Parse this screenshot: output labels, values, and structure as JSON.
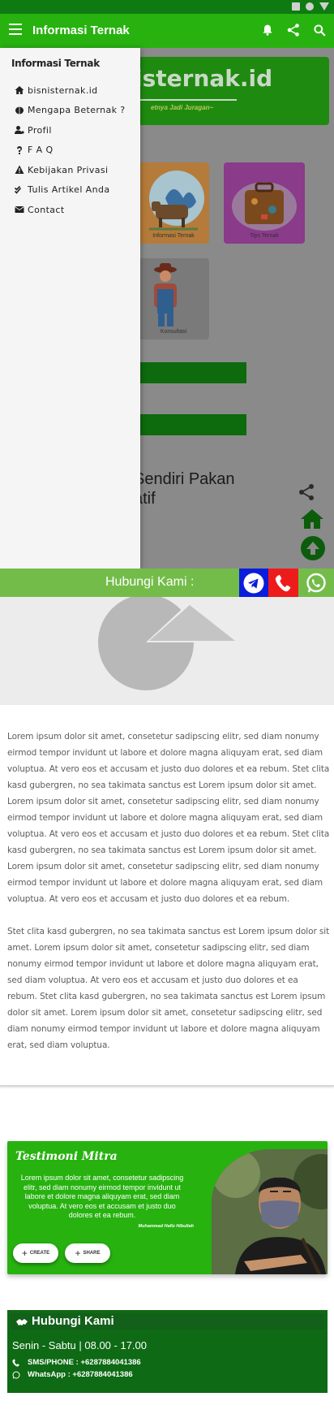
{
  "app_bar": {
    "title": "Informasi Ternak",
    "icons": [
      "menu-icon",
      "bell-icon",
      "share-icon",
      "search-icon"
    ],
    "color": "#27b210"
  },
  "background_page": {
    "hero_title": "isternak.id",
    "hero_subtitle": "etnya Jadi Juragan~",
    "tiles": [
      {
        "label": "Informasi Ternak"
      },
      {
        "label": "Tips Ternak"
      },
      {
        "label": "Konsultasi"
      }
    ],
    "article_title_line1": "Sendiri Pakan",
    "article_title_line2": "atif"
  },
  "drawer": {
    "title": "Informasi Ternak",
    "items": [
      {
        "label": "bisnisternak.id",
        "icon": "home-icon"
      },
      {
        "label": "Mengapa Beternak ?",
        "icon": "brain-icon"
      },
      {
        "label": "Profil",
        "icon": "user-gear-icon"
      },
      {
        "label": "F A Q",
        "icon": "question-icon"
      },
      {
        "label": "Kebijakan Privasi",
        "icon": "warning-icon"
      },
      {
        "label": "Tulis Artikel Anda",
        "icon": "check-double-icon"
      },
      {
        "label": "Contact",
        "icon": "envelope-icon"
      }
    ]
  },
  "contact_bar": {
    "label": "Hubungi Kami :",
    "buttons": [
      "telegram-icon",
      "phone-icon",
      "whatsapp-icon"
    ]
  },
  "article": {
    "paragraph1": "Lorem ipsum dolor sit amet, consetetur sadipscing elitr, sed diam nonumy eirmod tempor invidunt ut labore et dolore magna aliquyam erat, sed diam voluptua. At vero eos et accusam et justo duo dolores et ea rebum. Stet clita kasd gubergren, no sea takimata sanctus est Lorem ipsum dolor sit amet. Lorem ipsum dolor sit amet, consetetur sadipscing elitr, sed diam nonumy eirmod tempor invidunt ut labore et dolore magna aliquyam erat, sed diam voluptua. At vero eos et accusam et justo duo dolores et ea rebum. Stet clita kasd gubergren, no sea takimata sanctus est Lorem ipsum dolor sit amet. Lorem ipsum dolor sit amet, consetetur sadipscing elitr, sed diam nonumy eirmod tempor invidunt ut labore et dolore magna aliquyam erat, sed diam voluptua. At vero eos et accusam et justo duo dolores et ea rebum.",
    "paragraph2": "Stet clita kasd gubergren, no sea takimata sanctus est Lorem ipsum dolor sit amet. Lorem ipsum dolor sit amet, consetetur sadipscing elitr, sed diam nonumy eirmod tempor invidunt ut labore et dolore magna aliquyam erat, sed diam voluptua. At vero eos et accusam et justo duo dolores et ea rebum. Stet clita kasd gubergren, no sea takimata sanctus est Lorem ipsum dolor sit amet. Lorem ipsum dolor sit amet, consetetur sadipscing elitr, sed diam nonumy eirmod tempor invidunt ut labore et dolore magna aliquyam erat, sed diam voluptua."
  },
  "testimoni": {
    "title": "Testimoni Mitra",
    "quote": "Lorem ipsum dolor sit amet, consetetur sadipscing elitr, sed diam nonumy eirmod tempor invidunt ut labore et dolore magna aliquyam erat, sed diam voluptua. At vero eos et accusam et justo duo dolores et ea rebum.",
    "author": "Muhammad Hafiz Hibullah",
    "create_label": "CREATE",
    "share_label": "SHARE"
  },
  "footer": {
    "title": "Hubungi Kami",
    "hours": "Senin - Sabtu | 08.00 - 17.00",
    "sms": "SMS/PHONE : +6287884041386",
    "whatsapp": "WhatsApp : +6287884041386"
  }
}
